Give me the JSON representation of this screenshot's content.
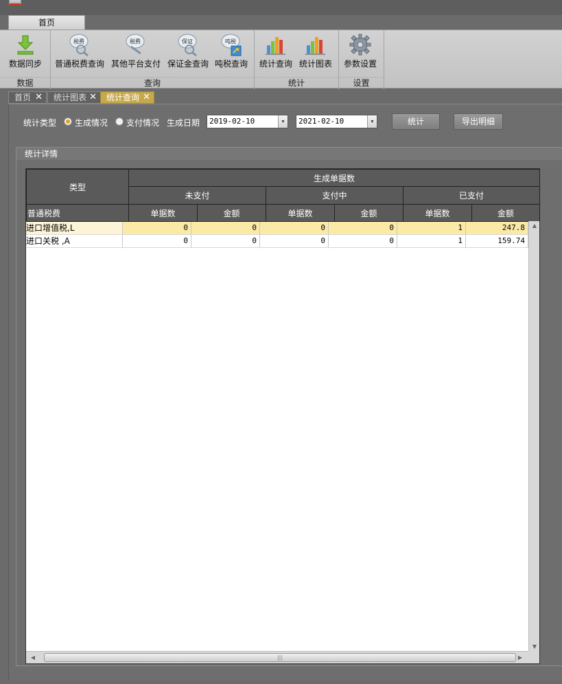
{
  "ribbon": {
    "tab": "首页",
    "groups": [
      {
        "label": "数据",
        "buttons": [
          {
            "label": "数据同步",
            "icon": "download-icon"
          }
        ]
      },
      {
        "label": "查询",
        "buttons": [
          {
            "label": "普通税费查询",
            "icon": "tax-query-icon"
          },
          {
            "label": "其他平台支付",
            "icon": "tax-pay-icon"
          },
          {
            "label": "保证金查询",
            "icon": "deposit-query-icon"
          },
          {
            "label": "吨税查询",
            "icon": "tonnage-tax-icon"
          }
        ]
      },
      {
        "label": "统计",
        "buttons": [
          {
            "label": "统计查询",
            "icon": "bar-chart-icon"
          },
          {
            "label": "统计图表",
            "icon": "bar-chart-icon"
          }
        ]
      },
      {
        "label": "设置",
        "buttons": [
          {
            "label": "参数设置",
            "icon": "gear-icon"
          }
        ]
      }
    ]
  },
  "doc_tabs": [
    {
      "label": "首页",
      "active": false
    },
    {
      "label": "统计图表",
      "active": false
    },
    {
      "label": "统计查询",
      "active": true
    }
  ],
  "filters": {
    "type_label": "统计类型",
    "option_generate": "生成情况",
    "option_pay": "支付情况",
    "selected": "生成情况",
    "date_label": "生成日期",
    "date_from": "2019-02-10",
    "date_to": "2021-02-10",
    "stat_button": "统计",
    "export_button": "导出明细"
  },
  "details": {
    "title": "统计详情",
    "header": {
      "type": "类型",
      "top": "生成单据数",
      "unpaid": "未支付",
      "paying": "支付中",
      "paid": "已支付",
      "category": "普通税费",
      "count": "单据数",
      "amount": "金额"
    },
    "rows": [
      {
        "name": "进口增值税,L",
        "c": [
          "0",
          "0",
          "0",
          "0",
          "1",
          "247.8"
        ]
      },
      {
        "name": "进口关税  ,A",
        "c": [
          "0",
          "0",
          "0",
          "0",
          "1",
          "159.74"
        ]
      }
    ]
  },
  "colors": {
    "accent_tab": "#c7a94c",
    "selected_row": "#fbe9a6",
    "radio_on": "#e0a020"
  }
}
